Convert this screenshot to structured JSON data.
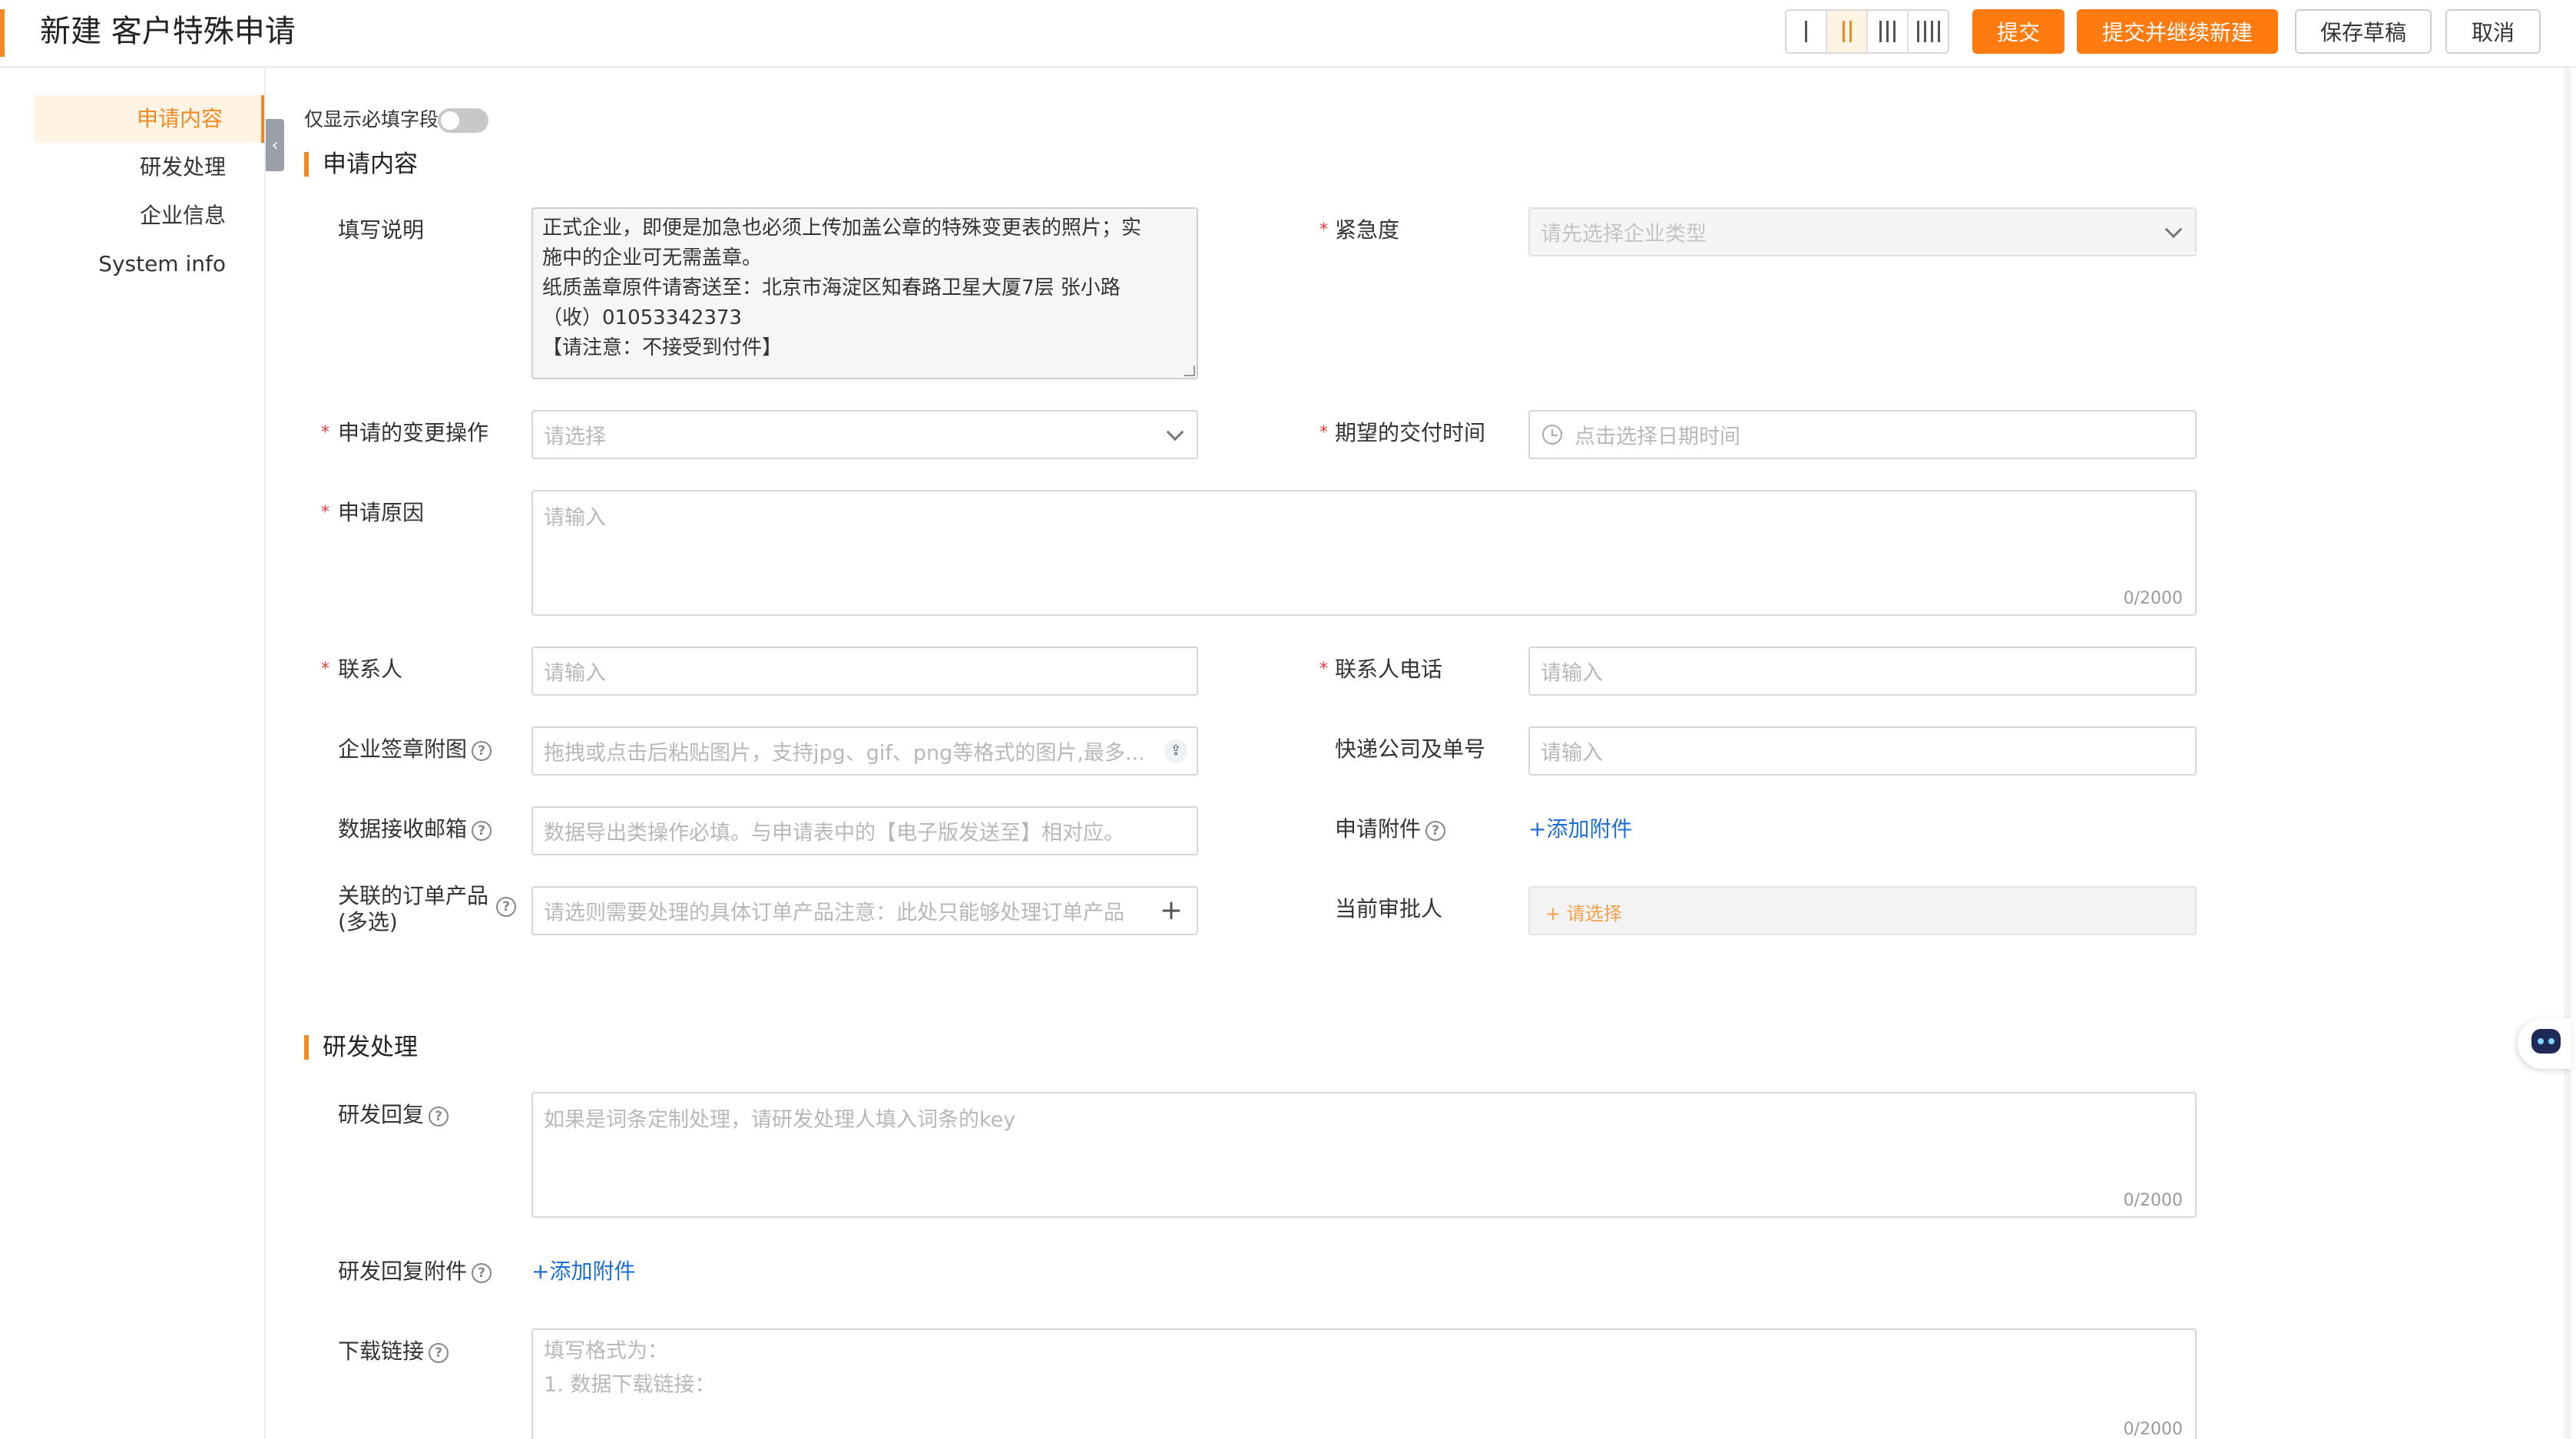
{
  "header": {
    "title": "新建 客户特殊申请",
    "layout_options": [
      "I",
      "II",
      "III",
      "IIII"
    ],
    "layout_selected": "II",
    "submit_label": "提交",
    "submit_continue_label": "提交并继续新建",
    "save_draft_label": "保存草稿",
    "cancel_label": "取消"
  },
  "nav": {
    "items": [
      {
        "label": "申请内容",
        "active": true
      },
      {
        "label": "研发处理",
        "active": false
      },
      {
        "label": "企业信息",
        "active": false
      },
      {
        "label": "System info",
        "active": false
      }
    ]
  },
  "toggle": {
    "label": "仅显示必填字段",
    "on": false
  },
  "sections": {
    "application": "申请内容",
    "rd": "研发处理"
  },
  "fields": {
    "instructions": {
      "label": "填写说明",
      "lines": [
        "正式企业，即便是加急也必须上传加盖公章的特殊变更表的照片；实",
        "施中的企业可无需盖章。",
        "纸质盖章原件请寄送至：北京市海淀区知春路卫星大厦7层   张小路",
        "（收）01053342373",
        "【请注意：不接受到付件】"
      ]
    },
    "urgency": {
      "label": "紧急度",
      "placeholder": "请先选择企业类型"
    },
    "change_operation": {
      "label": "申请的变更操作",
      "placeholder": "请选择"
    },
    "delivery_time": {
      "label": "期望的交付时间",
      "placeholder": "点击选择日期时间"
    },
    "reason": {
      "label": "申请原因",
      "placeholder": "请输入",
      "count": "0/2000"
    },
    "contact": {
      "label": "联系人",
      "placeholder": "请输入"
    },
    "contact_phone": {
      "label": "联系人电话",
      "placeholder": "请输入"
    },
    "seal_image": {
      "label": "企业签章附图",
      "placeholder": "拖拽或点击后粘贴图片，支持jpg、gif、png等格式的图片,最多..."
    },
    "express": {
      "label": "快递公司及单号",
      "placeholder": "请输入"
    },
    "email": {
      "label": "数据接收邮箱",
      "placeholder": "数据导出类操作必填。与申请表中的【电子版发送至】相对应。"
    },
    "attachment": {
      "label": "申请附件",
      "link": "+添加附件"
    },
    "products": {
      "label_line1": "关联的订单产品",
      "label_line2": "(多选)",
      "placeholder": "请选则需要处理的具体订单产品注意：此处只能够处理订单产品"
    },
    "approver": {
      "label": "当前审批人",
      "placeholder": "+ 请选择"
    },
    "rd_reply": {
      "label": "研发回复",
      "placeholder": "如果是词条定制处理，请研发处理人填入词条的key",
      "count": "0/2000"
    },
    "rd_attachment": {
      "label": "研发回复附件",
      "link": "+添加附件"
    },
    "download_link": {
      "label": "下载链接",
      "placeholder_line1": "填写格式为：",
      "placeholder_line2": "1. 数据下载链接：",
      "count": "0/2000"
    }
  },
  "colors": {
    "accent": "#f08a24",
    "primary_button": "#ff7a0f",
    "link": "#1c6fd9",
    "required": "#e53935"
  }
}
